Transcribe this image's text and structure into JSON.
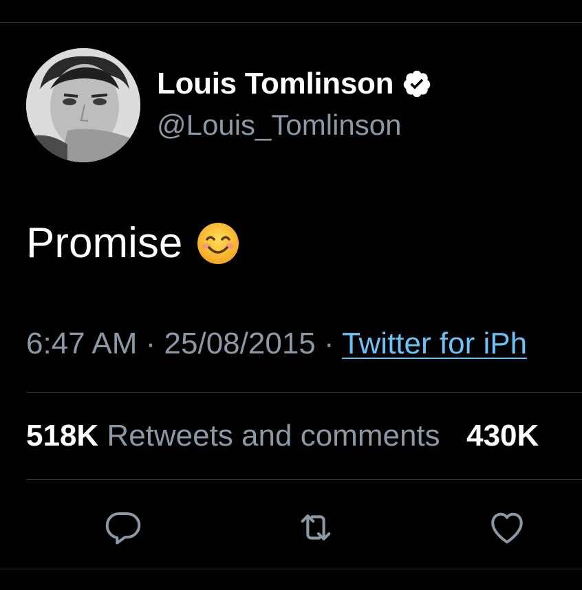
{
  "tweet": {
    "author": {
      "display_name": "Louis Tomlinson",
      "handle": "@Louis_Tomlinson",
      "verified": true,
      "avatar_icon": "profile-photo"
    },
    "text": "Promise",
    "emoji": "smiling-face-with-smiling-eyes",
    "time": "6:47 AM",
    "date": "25/08/2015",
    "separator": " · ",
    "source": "Twitter for iPh",
    "stats": {
      "retweets_count": "518K",
      "retweets_label": "Retweets and comments",
      "likes_count": "430K"
    },
    "actions": [
      {
        "icon": "reply-icon"
      },
      {
        "icon": "retweet-icon"
      },
      {
        "icon": "like-icon"
      }
    ]
  },
  "colors": {
    "background": "#000000",
    "primary_text": "#ffffff",
    "secondary_text": "#8b98a5",
    "link": "#6cc2f5",
    "divider": "#2f3336"
  }
}
